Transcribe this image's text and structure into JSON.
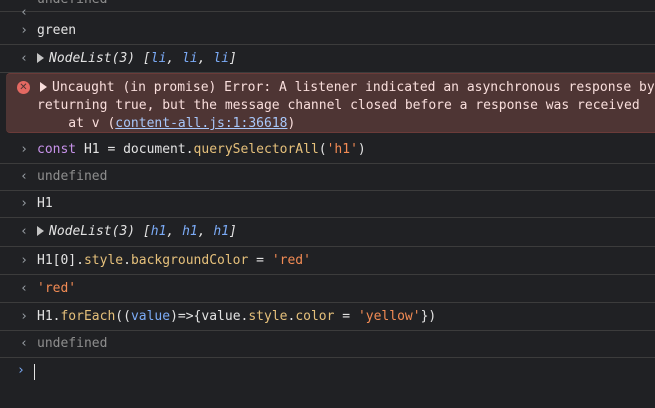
{
  "rows": [
    {
      "kind": "result",
      "text": "undefined"
    },
    {
      "kind": "input",
      "text": "green"
    },
    {
      "kind": "result-nodelist",
      "type_label": "NodeList(3)",
      "items": [
        "li",
        "li",
        "li"
      ]
    },
    {
      "kind": "input-code-1"
    },
    {
      "kind": "result",
      "text": "undefined"
    },
    {
      "kind": "input",
      "text": "H1"
    },
    {
      "kind": "result-nodelist",
      "type_label": "NodeList(3)",
      "items": [
        "h1",
        "h1",
        "h1"
      ]
    },
    {
      "kind": "input-code-2"
    },
    {
      "kind": "result-string",
      "text": "'red'"
    },
    {
      "kind": "input-code-3"
    },
    {
      "kind": "result",
      "text": "undefined"
    }
  ],
  "error": {
    "line1": "Uncaught (in promise) Error: A listener indicated an asynchronous response by",
    "line2": "returning true, but the message channel closed before a response was received",
    "line3_prefix": "    at v (",
    "link": "content-all.js:1:36618",
    "line3_suffix": ")"
  },
  "code1": {
    "kw": "const",
    "var": " H1 = document.",
    "fn": "querySelectorAll",
    "open": "(",
    "arg": "'h1'",
    "close": ")"
  },
  "code2": {
    "a": "H1[0].",
    "p1": "style",
    "dot": ".",
    "p2": "backgroundColor",
    "eq": " = ",
    "str": "'red'"
  },
  "code3": {
    "a": "H1.",
    "fn": "forEach",
    "b": "((",
    "param": "value",
    "c": ")=>{value.",
    "p1": "style",
    "dot": ".",
    "p2": "color",
    "eq": " = ",
    "str": "'yellow'",
    "d": "})"
  },
  "icons": {
    "input": "chevron-right",
    "result": "chevron-left",
    "expand": "triangle-right",
    "error": "error-circle",
    "prompt": "chevron-right-blue"
  },
  "colors": {
    "background": "#202124",
    "error_bg": "#4e3534",
    "string": "#f28b54",
    "keyword": "#c792ea",
    "property": "#e5c07b",
    "link": "#a8c7fa"
  }
}
